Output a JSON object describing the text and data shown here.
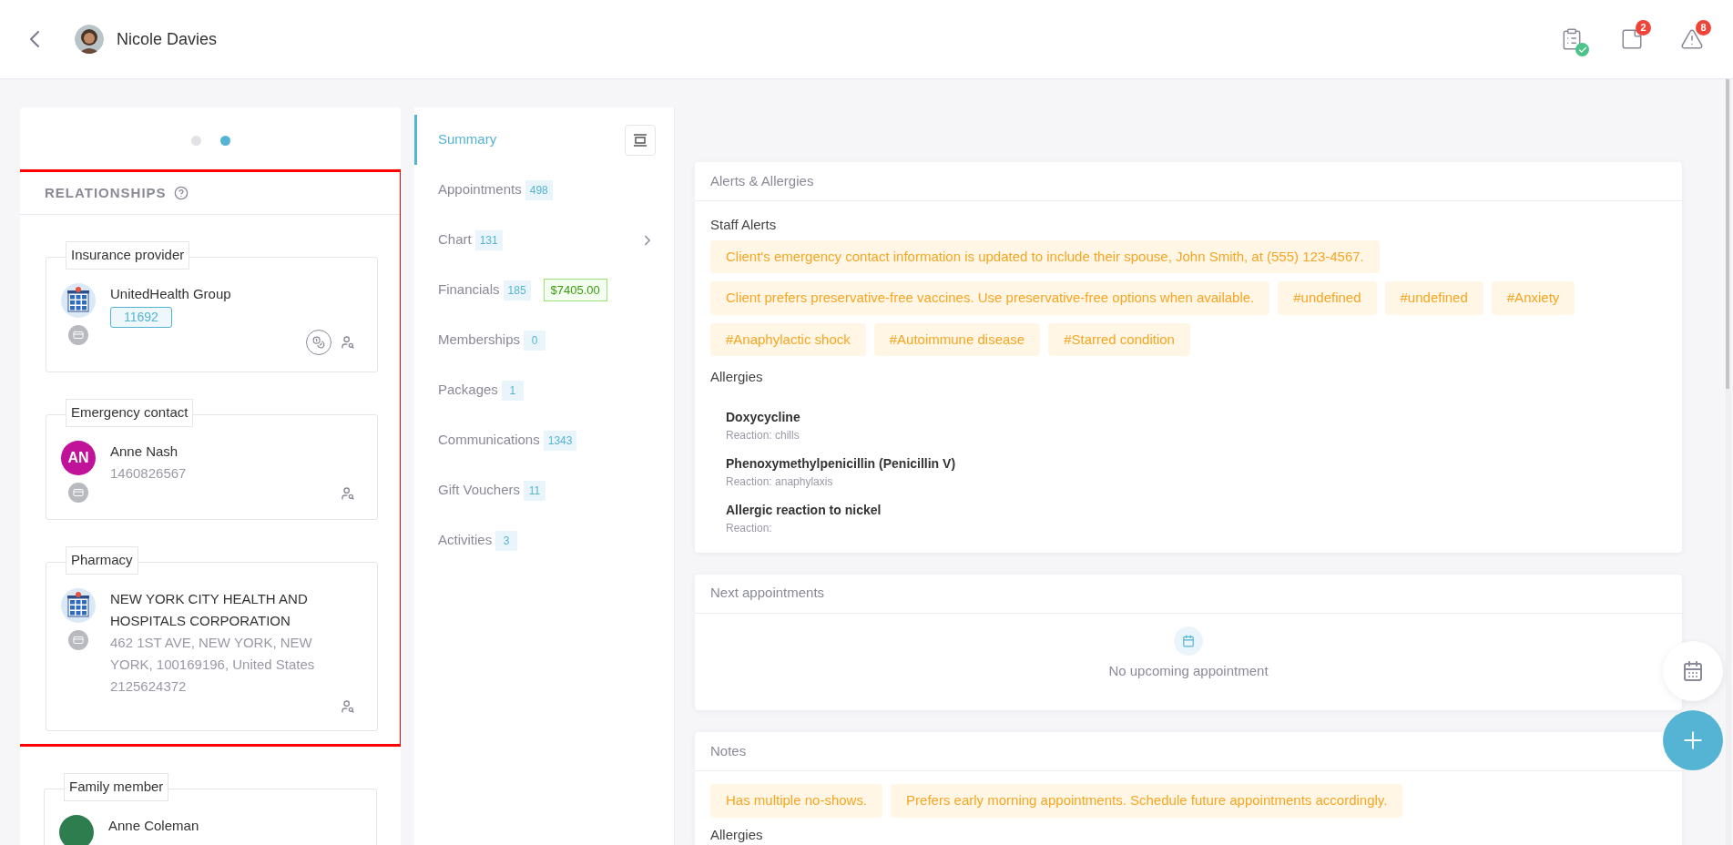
{
  "header": {
    "patient_name": "Nicole Davies",
    "icons": [
      {
        "kind": "clipboard",
        "checked": true
      },
      {
        "kind": "notes",
        "badge": "2",
        "checked": false
      },
      {
        "kind": "warning",
        "badge": "8",
        "checked": false
      }
    ]
  },
  "carousel": {
    "dots": [
      {
        "selected": false
      },
      {
        "selected": true
      }
    ]
  },
  "relationships": {
    "title": "RELATIONSHIPS",
    "highlighted": true,
    "cards": [
      {
        "type": "Insurance provider",
        "avatar": {
          "kind": "building"
        },
        "name": "UnitedHealth Group",
        "badge": "11692",
        "billing_action": true
      },
      {
        "type": "Emergency contact",
        "avatar": {
          "kind": "initials",
          "text": "AN",
          "color": "#c0139a"
        },
        "name": "Anne Nash",
        "details": [
          "1460826567"
        ],
        "billing_action": false
      },
      {
        "type": "Pharmacy",
        "avatar": {
          "kind": "building"
        },
        "name": "NEW YORK CITY HEALTH AND HOSPITALS CORPORATION",
        "details": [
          "462 1ST AVE, NEW YORK, NEW YORK, 100169196, United States",
          "2125624372"
        ],
        "billing_action": false
      }
    ],
    "cards_below": [
      {
        "type": "Family member",
        "avatar": {
          "kind": "initials",
          "color": "#2e7d4f"
        },
        "name": "Anne Coleman",
        "billing_action": false
      }
    ]
  },
  "nav": [
    {
      "label": "Summary",
      "selected": true,
      "collapse": true
    },
    {
      "label": "Appointments",
      "count": "498",
      "selected": false
    },
    {
      "label": "Chart",
      "count": "131",
      "selected": false,
      "submenu": true
    },
    {
      "label": "Financials",
      "count": "185",
      "amount": "$7405.00",
      "selected": false
    },
    {
      "label": "Memberships",
      "count": "0",
      "selected": false
    },
    {
      "label": "Packages",
      "count": "1",
      "selected": false
    },
    {
      "label": "Communications",
      "count": "1343",
      "selected": false
    },
    {
      "label": "Gift Vouchers",
      "count": "11",
      "selected": false
    },
    {
      "label": "Activities",
      "count": "3",
      "selected": false
    }
  ],
  "alerts": {
    "title": "Alerts & Allergies",
    "staff_alerts_heading": "Staff Alerts",
    "staff_alerts": [
      "Client's emergency contact information is updated to include their spouse, John Smith, at (555) 123-4567.",
      "Client prefers preservative-free vaccines. Use preservative-free options when available.",
      "#undefined",
      "#undefined",
      "#Anxiety",
      "#Anaphylactic shock",
      "#Autoimmune disease",
      "#Starred condition"
    ],
    "allergies_heading": "Allergies",
    "allergies": [
      {
        "name": "Doxycycline",
        "reaction": "Reaction: chills"
      },
      {
        "name": "Phenoxymethylpenicillin (Penicillin V)",
        "reaction": "Reaction: anaphylaxis"
      },
      {
        "name": "Allergic reaction to nickel",
        "reaction": "Reaction:"
      }
    ]
  },
  "next_appointments": {
    "title": "Next appointments",
    "empty_text": "No upcoming appointment"
  },
  "notes": {
    "title": "Notes",
    "tags": [
      "Has multiple no-shows.",
      "Prefers early morning appointments. Schedule future appointments accordingly."
    ],
    "allergies_heading": "Allergies"
  }
}
